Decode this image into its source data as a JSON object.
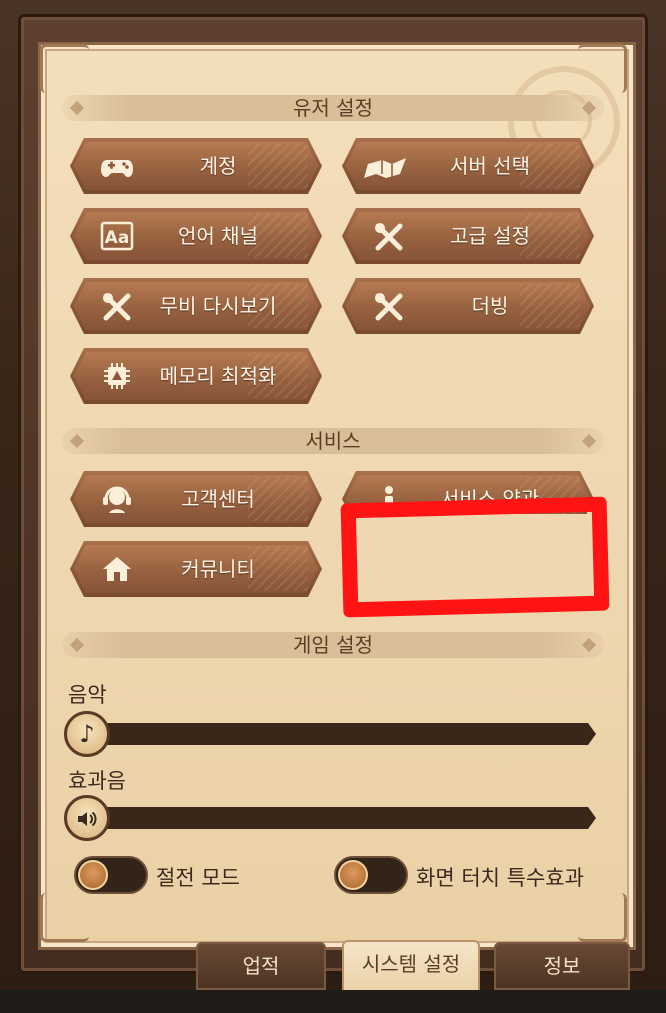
{
  "sections": {
    "user": "유저 설정",
    "service": "서비스",
    "game": "게임 설정"
  },
  "user_buttons": [
    {
      "label": "계정",
      "icon": "gamepad-icon"
    },
    {
      "label": "서버 선택",
      "icon": "server-map-icon"
    },
    {
      "label": "언어 채널",
      "icon": "language-aa-icon"
    },
    {
      "label": "고급 설정",
      "icon": "tools-icon"
    },
    {
      "label": "무비 다시보기",
      "icon": "tools-icon"
    },
    {
      "label": "더빙",
      "icon": "tools-icon"
    },
    {
      "label": "메모리 최적화",
      "icon": "chip-icon"
    }
  ],
  "service_buttons": [
    {
      "label": "고객센터",
      "icon": "support-headset-icon"
    },
    {
      "label": "서비스 약관",
      "icon": "info-icon"
    },
    {
      "label": "커뮤니티",
      "icon": "home-icon"
    }
  ],
  "sliders": {
    "music": {
      "label": "음악",
      "value_percent": 0,
      "icon": "music-note-icon"
    },
    "sfx": {
      "label": "효과음",
      "value_percent": 0,
      "icon": "speaker-icon"
    }
  },
  "toggles": {
    "power_save": {
      "label": "절전 모드",
      "on": false
    },
    "touch_effect": {
      "label": "화면 터치 특수효과",
      "on": false
    }
  },
  "tabs": [
    {
      "label": "업적",
      "active": false
    },
    {
      "label": "시스템 설정",
      "active": true
    },
    {
      "label": "정보",
      "active": false
    }
  ],
  "colors": {
    "paper": "#efd8b1",
    "button": "#95603e",
    "annotation_red": "#ff1313"
  }
}
